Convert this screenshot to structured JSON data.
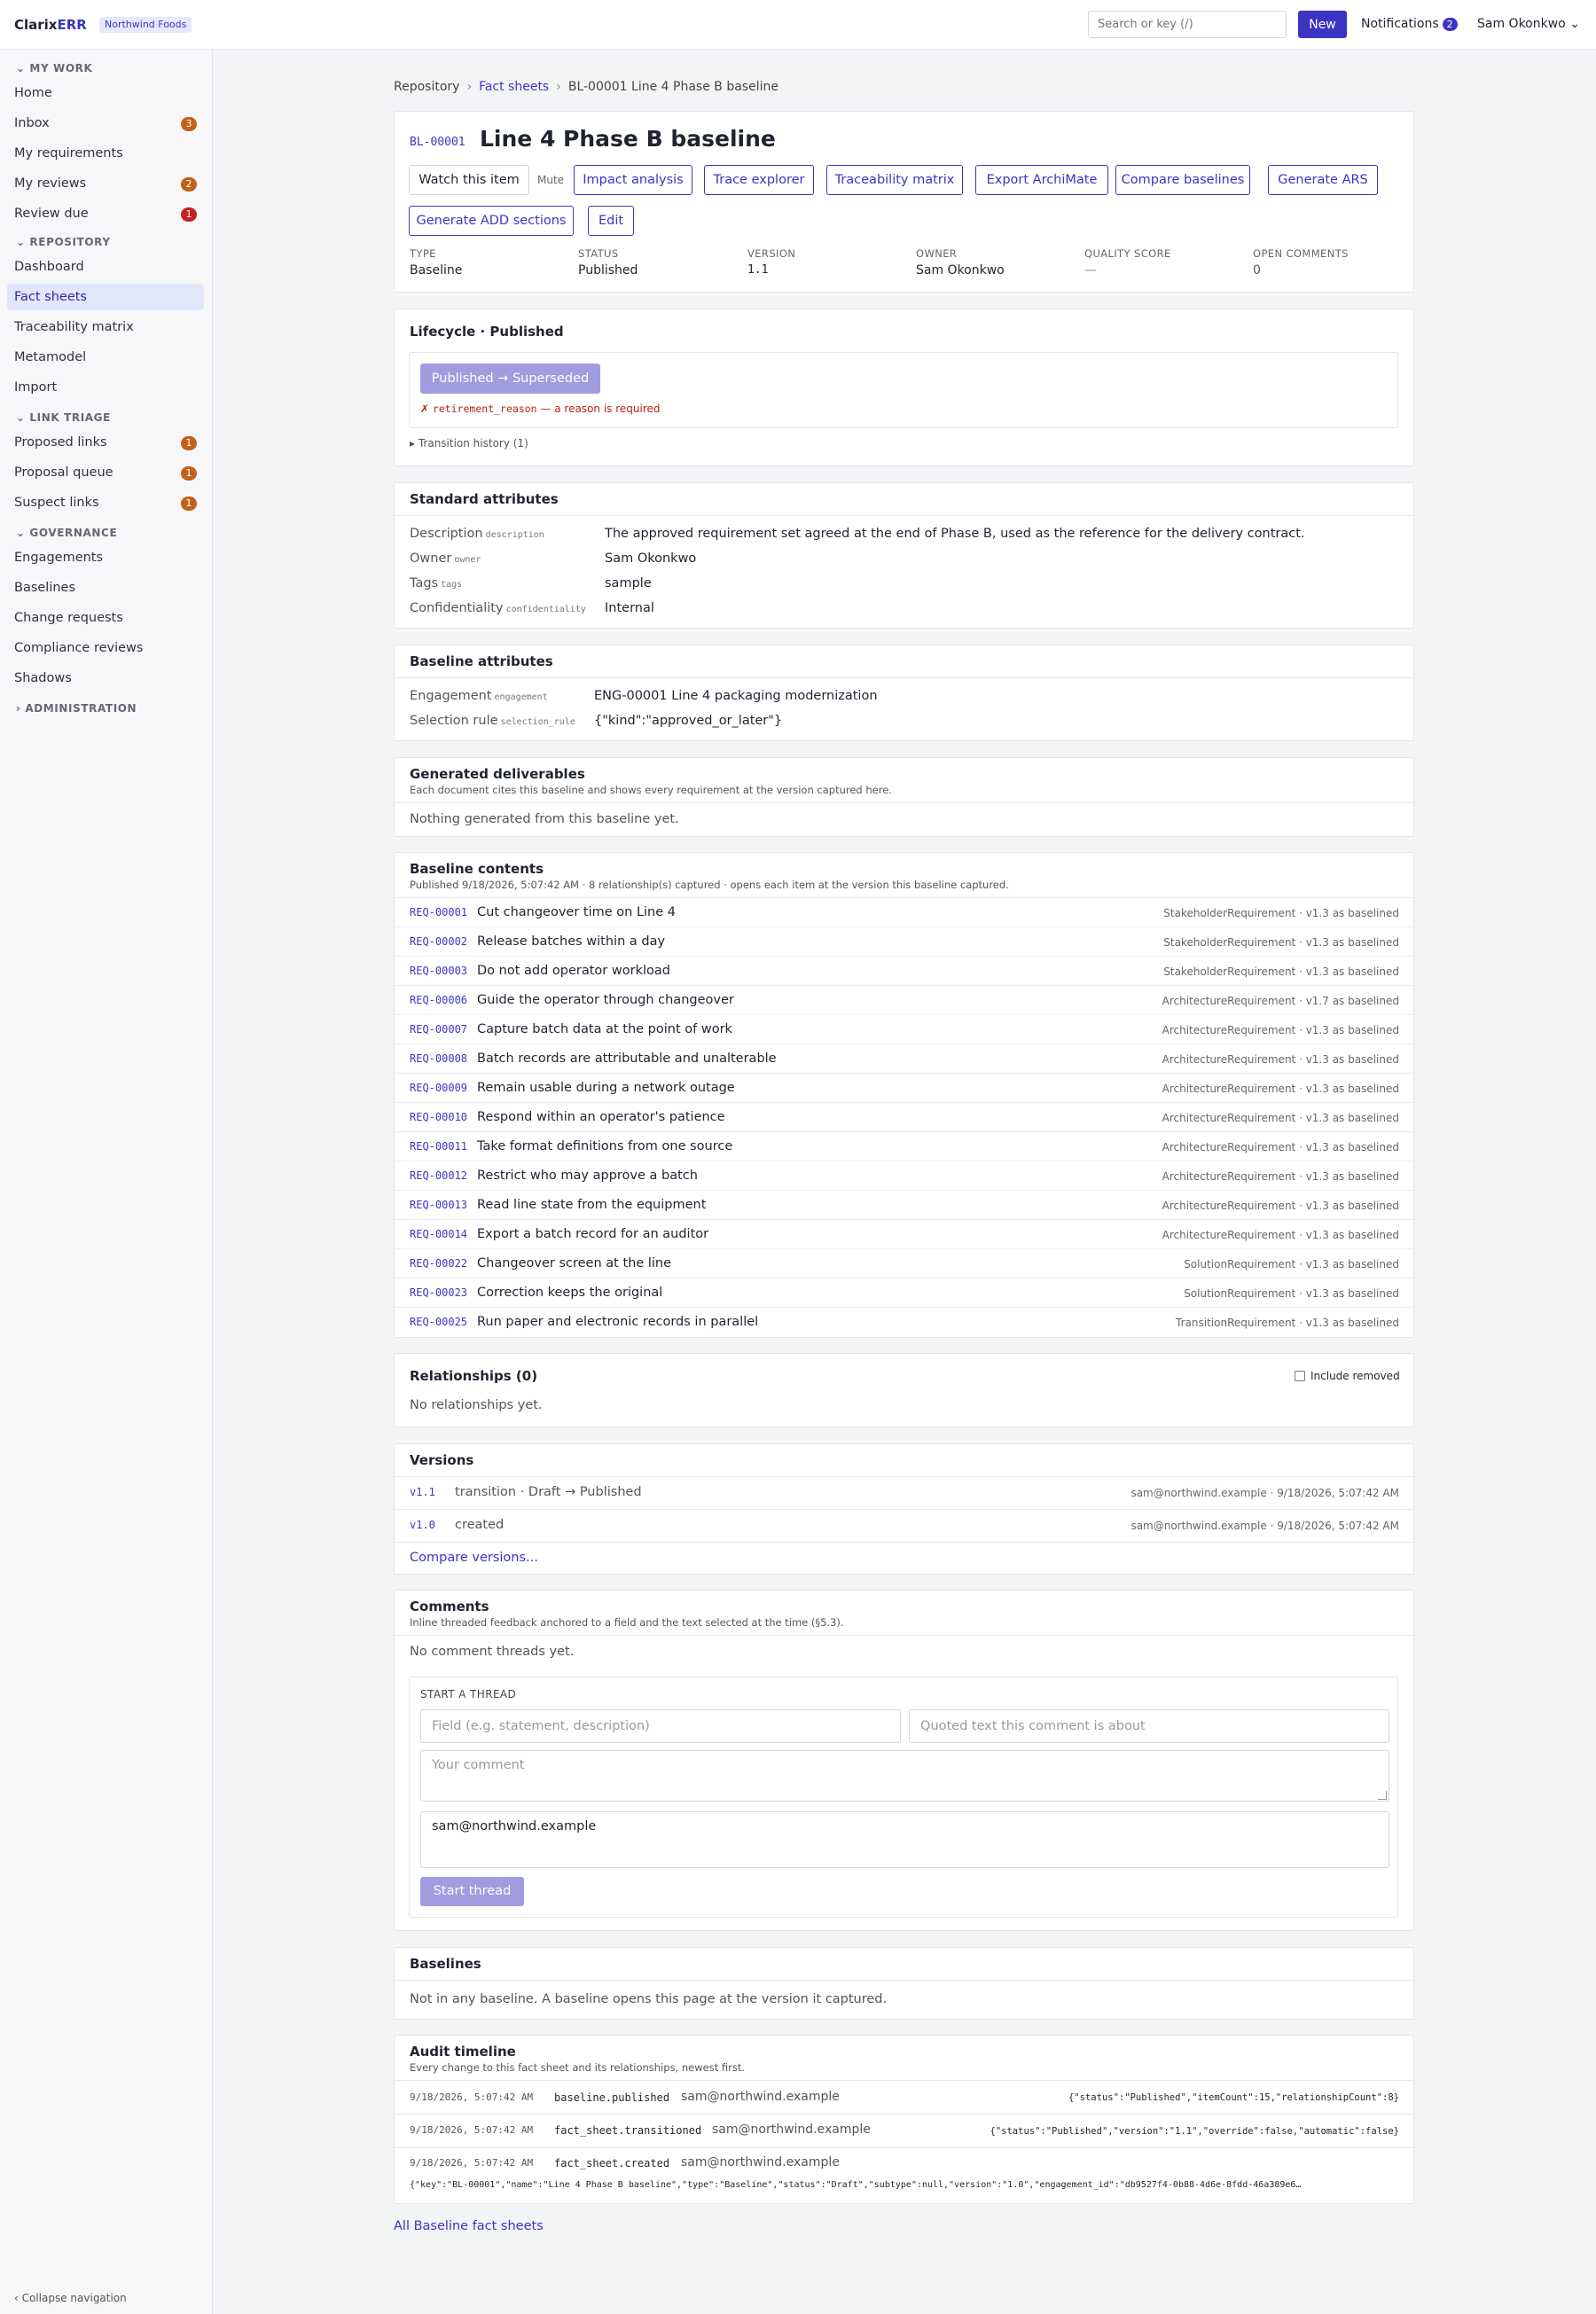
{
  "app": {
    "brand_a": "Clarix",
    "brand_b": "ERR",
    "org": "Northwind Foods"
  },
  "topbar": {
    "search_placeholder": "Search or key (/)",
    "new_label": "New",
    "notifications_label": "Notifications",
    "notifications_count": "2",
    "user": "Sam Okonkwo ⌄"
  },
  "sidebar": {
    "sections": [
      {
        "label": "⌄ MY WORK"
      },
      {
        "label": "⌄ REPOSITORY"
      },
      {
        "label": "⌄ LINK TRIAGE"
      },
      {
        "label": "⌄ GOVERNANCE"
      },
      {
        "label": "› ADMINISTRATION"
      }
    ],
    "items": [
      {
        "label": "Home"
      },
      {
        "label": "Inbox",
        "badge": "3"
      },
      {
        "label": "My requirements"
      },
      {
        "label": "My reviews",
        "badge": "2"
      },
      {
        "label": "Review due",
        "badge": "1"
      },
      {
        "label": "Dashboard"
      },
      {
        "label": "Fact sheets"
      },
      {
        "label": "Traceability matrix"
      },
      {
        "label": "Metamodel"
      },
      {
        "label": "Import"
      },
      {
        "label": "Proposed links",
        "badge": "1"
      },
      {
        "label": "Proposal queue",
        "badge": "1"
      },
      {
        "label": "Suspect links",
        "badge": "1"
      },
      {
        "label": "Engagements"
      },
      {
        "label": "Baselines"
      },
      {
        "label": "Change requests"
      },
      {
        "label": "Compliance reviews"
      },
      {
        "label": "Shadows"
      }
    ],
    "collapse_label": "‹ Collapse navigation"
  },
  "breadcrumb": {
    "root": "Repository",
    "parent": "Fact sheets",
    "current": "BL-00001 Line 4 Phase B baseline",
    "sep": "›"
  },
  "header": {
    "key": "BL-00001",
    "title": "Line 4 Phase B baseline",
    "watch_label": "Watch this item",
    "mute_label": "Mute",
    "actions": [
      "Impact analysis",
      "Trace explorer",
      "Traceability matrix",
      "Export ArchiMate",
      "Compare baselines",
      "Generate ARS",
      "Generate ADD sections",
      "Edit"
    ],
    "meta": [
      {
        "label": "TYPE",
        "value": "Baseline"
      },
      {
        "label": "STATUS",
        "value": "Published"
      },
      {
        "label": "VERSION",
        "value": "1.1"
      },
      {
        "label": "OWNER",
        "value": "Sam Okonkwo"
      },
      {
        "label": "QUALITY SCORE",
        "value": "—"
      },
      {
        "label": "OPEN COMMENTS",
        "value": "0"
      }
    ]
  },
  "lifecycle": {
    "title": "Lifecycle · Published",
    "transition_button": "Published → Superseded",
    "error_prefix": "✗",
    "error_code": "retirement_reason",
    "error_text": "— a reason is required",
    "history_label": "▸ Transition history (1)"
  },
  "standard_attributes": {
    "title": "Standard attributes",
    "rows": [
      {
        "label": "Description",
        "code": "description",
        "value": "The approved requirement set agreed at the end of Phase B, used as the reference for the delivery contract."
      },
      {
        "label": "Owner",
        "code": "owner",
        "value": "Sam Okonkwo"
      },
      {
        "label": "Tags",
        "code": "tags",
        "value": "sample"
      },
      {
        "label": "Confidentiality",
        "code": "confidentiality",
        "value": "Internal"
      }
    ]
  },
  "baseline_attributes": {
    "title": "Baseline attributes",
    "rows": [
      {
        "label": "Engagement",
        "code": "engagement",
        "value": "ENG-00001 Line 4 packaging modernization"
      },
      {
        "label": "Selection rule",
        "code": "selection_rule",
        "value": "{\"kind\":\"approved_or_later\"}"
      }
    ]
  },
  "deliverables": {
    "title": "Generated deliverables",
    "subtitle": "Each document cites this baseline and shows every requirement at the version captured here.",
    "empty": "Nothing generated from this baseline yet."
  },
  "contents": {
    "title": "Baseline contents",
    "subtitle": "Published 9/18/2026, 5:07:42 AM · 8 relationship(s) captured · opens each item at the version this baseline captured.",
    "items": [
      {
        "key": "REQ-00001",
        "name": "Cut changeover time on Line 4",
        "meta": "StakeholderRequirement · v1.3 as baselined"
      },
      {
        "key": "REQ-00002",
        "name": "Release batches within a day",
        "meta": "StakeholderRequirement · v1.3 as baselined"
      },
      {
        "key": "REQ-00003",
        "name": "Do not add operator workload",
        "meta": "StakeholderRequirement · v1.3 as baselined"
      },
      {
        "key": "REQ-00006",
        "name": "Guide the operator through changeover",
        "meta": "ArchitectureRequirement · v1.7 as baselined"
      },
      {
        "key": "REQ-00007",
        "name": "Capture batch data at the point of work",
        "meta": "ArchitectureRequirement · v1.3 as baselined"
      },
      {
        "key": "REQ-00008",
        "name": "Batch records are attributable and unalterable",
        "meta": "ArchitectureRequirement · v1.3 as baselined"
      },
      {
        "key": "REQ-00009",
        "name": "Remain usable during a network outage",
        "meta": "ArchitectureRequirement · v1.3 as baselined"
      },
      {
        "key": "REQ-00010",
        "name": "Respond within an operator's patience",
        "meta": "ArchitectureRequirement · v1.3 as baselined"
      },
      {
        "key": "REQ-00011",
        "name": "Take format definitions from one source",
        "meta": "ArchitectureRequirement · v1.3 as baselined"
      },
      {
        "key": "REQ-00012",
        "name": "Restrict who may approve a batch",
        "meta": "ArchitectureRequirement · v1.3 as baselined"
      },
      {
        "key": "REQ-00013",
        "name": "Read line state from the equipment",
        "meta": "ArchitectureRequirement · v1.3 as baselined"
      },
      {
        "key": "REQ-00014",
        "name": "Export a batch record for an auditor",
        "meta": "ArchitectureRequirement · v1.3 as baselined"
      },
      {
        "key": "REQ-00022",
        "name": "Changeover screen at the line",
        "meta": "SolutionRequirement · v1.3 as baselined"
      },
      {
        "key": "REQ-00023",
        "name": "Correction keeps the original",
        "meta": "SolutionRequirement · v1.3 as baselined"
      },
      {
        "key": "REQ-00025",
        "name": "Run paper and electronic records in parallel",
        "meta": "TransitionRequirement · v1.3 as baselined"
      }
    ]
  },
  "relationships": {
    "title": "Relationships (0)",
    "include_removed": "Include removed",
    "empty": "No relationships yet."
  },
  "versions": {
    "title": "Versions",
    "items": [
      {
        "version": "v1.1",
        "desc": "transition · Draft → Published",
        "meta": "sam@northwind.example · 9/18/2026, 5:07:42 AM"
      },
      {
        "version": "v1.0",
        "desc": "created",
        "meta": "sam@northwind.example · 9/18/2026, 5:07:42 AM"
      }
    ],
    "compare_link": "Compare versions..."
  },
  "comments": {
    "title": "Comments",
    "subtitle": "Inline threaded feedback anchored to a field and the text selected at the time (§5.3).",
    "empty": "No comment threads yet.",
    "start_label": "START A THREAD",
    "field_placeholder": "Field (e.g. statement, description)",
    "quote_placeholder": "Quoted text this comment is about",
    "comment_placeholder": "Your comment",
    "author_value": "sam@northwind.example",
    "submit_label": "Start thread"
  },
  "baselines_section": {
    "title": "Baselines",
    "empty": "Not in any baseline. A baseline opens this page at the version it captured."
  },
  "audit": {
    "title": "Audit timeline",
    "subtitle": "Every change to this fact sheet and its relationships, newest first.",
    "entries": [
      {
        "time": "9/18/2026, 5:07:42 AM",
        "event": "baseline.published",
        "actor": "sam@northwind.example",
        "payload": "{\"status\":\"Published\",\"itemCount\":15,\"relationshipCount\":8}"
      },
      {
        "time": "9/18/2026, 5:07:42 AM",
        "event": "fact_sheet.transitioned",
        "actor": "sam@northwind.example",
        "payload": "{\"status\":\"Published\",\"version\":\"1.1\",\"override\":false,\"automatic\":false}"
      },
      {
        "time": "9/18/2026, 5:07:42 AM",
        "event": "fact_sheet.created",
        "actor": "sam@northwind.example",
        "payload": "{\"key\":\"BL-00001\",\"name\":\"Line 4 Phase B baseline\",\"type\":\"Baseline\",\"status\":\"Draft\",\"subtype\":null,\"version\":\"1.0\",\"engagement_id\":\"db9527f4-0b88-4d6e-8fdd-46a389e6…"
      }
    ]
  },
  "footer_link": "All Baseline fact sheets"
}
